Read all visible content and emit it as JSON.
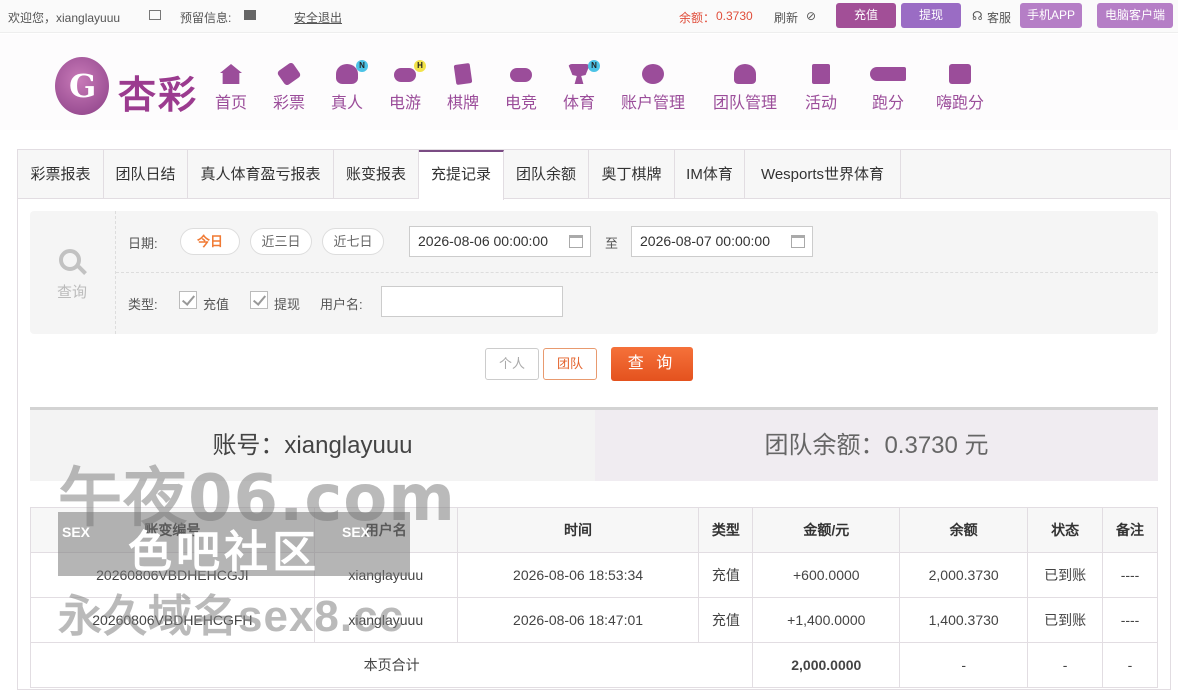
{
  "topbar": {
    "welcome": "欢迎您，xianglayuuu",
    "reserved_info": "预留信息:",
    "logout": "安全退出",
    "balance_label": "余额：",
    "balance_value": "0.3730",
    "refresh": "刷新",
    "recharge": "充值",
    "withdraw": "提现",
    "service": "客服",
    "mobile_app": "手机APP",
    "pc_client": "电脑客户端"
  },
  "logo": {
    "text": "杏彩",
    "glyph": "G"
  },
  "nav": [
    {
      "label": "首页",
      "icon": "home-icon"
    },
    {
      "label": "彩票",
      "icon": "lottery-icon"
    },
    {
      "label": "真人",
      "icon": "live-dealer-icon",
      "badge": "N"
    },
    {
      "label": "电游",
      "icon": "gamepad-icon",
      "badge": "H"
    },
    {
      "label": "棋牌",
      "icon": "cards-icon"
    },
    {
      "label": "电竞",
      "icon": "esports-icon"
    },
    {
      "label": "体育",
      "icon": "trophy-icon",
      "badge": "N"
    },
    {
      "label": "账户管理",
      "icon": "account-icon"
    },
    {
      "label": "团队管理",
      "icon": "team-icon"
    },
    {
      "label": "活动",
      "icon": "gift-icon"
    },
    {
      "label": "跑分",
      "icon": "running-icon"
    },
    {
      "label": "嗨跑分",
      "icon": "hi-icon"
    }
  ],
  "tabs": [
    "彩票报表",
    "团队日结",
    "真人体育盈亏报表",
    "账变报表",
    "充提记录",
    "团队余额",
    "奥丁棋牌",
    "IM体育",
    "Wesports世界体育"
  ],
  "active_tab": "充提记录",
  "filter": {
    "search_label": "查询",
    "date_label": "日期:",
    "quick_dates": [
      "今日",
      "近三日",
      "近七日"
    ],
    "date_from": "2026-08-06 00:00:00",
    "to": "至",
    "date_to": "2026-08-07 00:00:00",
    "type_label": "类型:",
    "type_recharge": "充值",
    "type_withdraw": "提现",
    "username_label": "用户名:",
    "username_value": ""
  },
  "actions": {
    "personal": "个人",
    "team": "团队",
    "query": "查 询"
  },
  "summary": {
    "account": "账号：xianglayuuu",
    "team_balance": "团队余额：0.3730 元"
  },
  "table": {
    "headers": [
      "账变编号",
      "用户名",
      "时间",
      "类型",
      "金额/元",
      "余额",
      "状态",
      "备注"
    ],
    "rows": [
      {
        "id": "20260806VBDHEHCGJI",
        "user": "xianglayuuu",
        "time": "2026-08-06 18:53:34",
        "type": "充值",
        "amount": "+600.0000",
        "balance": "2,000.3730",
        "status": "已到账",
        "note": "----"
      },
      {
        "id": "20260806VBDHEHCGFH",
        "user": "xianglayuuu",
        "time": "2026-08-06 18:47:01",
        "type": "充值",
        "amount": "+1,400.0000",
        "balance": "1,400.3730",
        "status": "已到账",
        "note": "----"
      }
    ],
    "footer": {
      "label": "本页合计",
      "amount": "2,000.0000",
      "balance": "-",
      "status": "-",
      "note": "-"
    }
  },
  "watermark": {
    "line1": "午夜06.com",
    "badge_left": "SEX",
    "line2": "色吧社区",
    "badge_right": "SEX",
    "line3": "永久域名sex8.cc"
  },
  "colors": {
    "brand_purple": "#9b4d9a",
    "orange": "#e4521e",
    "green": "#4aa33b",
    "red": "#e04d3a"
  }
}
